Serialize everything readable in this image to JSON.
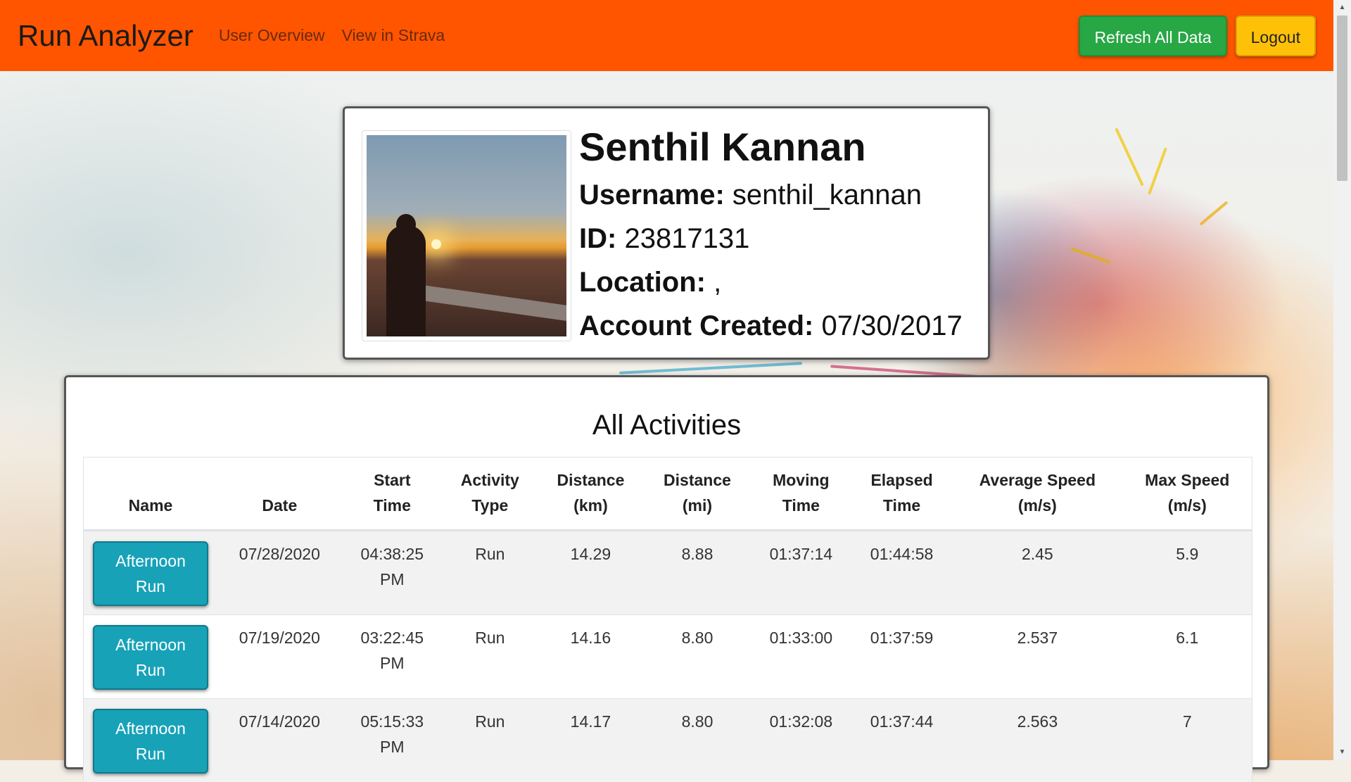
{
  "navbar": {
    "brand": "Run Analyzer",
    "links": [
      "User Overview",
      "View in Strava"
    ],
    "refresh_label": "Refresh All Data",
    "logout_label": "Logout",
    "color": "#ff5500"
  },
  "profile": {
    "name": "Senthil Kannan",
    "username_label": "Username:",
    "username": "senthil_kannan",
    "id_label": "ID:",
    "id": "23817131",
    "location_label": "Location:",
    "location": ",",
    "created_label": "Account Created:",
    "created": "07/30/2017"
  },
  "activities": {
    "title": "All Activities",
    "headers": {
      "name": "Name",
      "date": "Date",
      "start_1": "Start",
      "start_2": "Time",
      "type_1": "Activity",
      "type_2": "Type",
      "dkm_1": "Distance",
      "dkm_2": "(km)",
      "dmi_1": "Distance",
      "dmi_2": "(mi)",
      "moving_1": "Moving",
      "moving_2": "Time",
      "elapsed_1": "Elapsed",
      "elapsed_2": "Time",
      "avg_1": "Average Speed",
      "avg_2": "(m/s)",
      "max_1": "Max Speed",
      "max_2": "(m/s)"
    },
    "rows": [
      {
        "name_1": "Afternoon",
        "name_2": "Run",
        "date": "07/28/2020",
        "start_1": "04:38:25",
        "start_2": "PM",
        "type": "Run",
        "dist_km": "14.29",
        "dist_mi": "8.88",
        "moving": "01:37:14",
        "elapsed": "01:44:58",
        "avg": "2.45",
        "max": "5.9"
      },
      {
        "name_1": "Afternoon",
        "name_2": "Run",
        "date": "07/19/2020",
        "start_1": "03:22:45",
        "start_2": "PM",
        "type": "Run",
        "dist_km": "14.16",
        "dist_mi": "8.80",
        "moving": "01:33:00",
        "elapsed": "01:37:59",
        "avg": "2.537",
        "max": "6.1"
      },
      {
        "name_1": "Afternoon",
        "name_2": "Run",
        "date": "07/14/2020",
        "start_1": "05:15:33",
        "start_2": "PM",
        "type": "Run",
        "dist_km": "14.17",
        "dist_mi": "8.80",
        "moving": "01:32:08",
        "elapsed": "01:37:44",
        "avg": "2.563",
        "max": "7"
      }
    ]
  }
}
